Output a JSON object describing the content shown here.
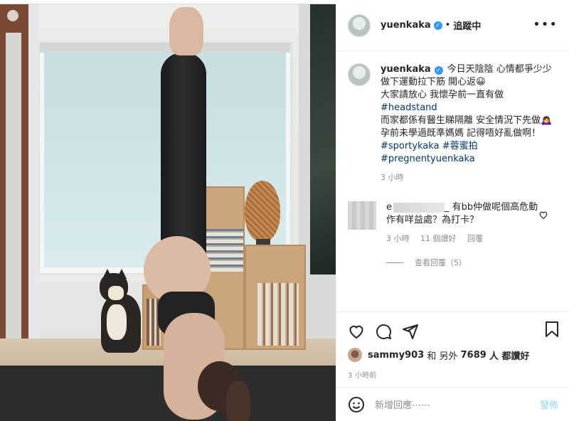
{
  "post": {
    "username": "yuenkaka",
    "separator": "•",
    "follow_label": "追蹤中",
    "more_label": "•••"
  },
  "caption": {
    "username": "yuenkaka",
    "line1": "今日天陰陰 心情都爭少少",
    "line2": "做下運動拉下筋 開心返😀",
    "line3": "大家請放心 我懷孕前一直有做",
    "hashtag1": "#headstand",
    "line4": "而家都係有醫生睇隔離 安全情況下先做🙇‍♀️",
    "line5": "孕前未學過既準媽媽 記得唔好亂做啊！",
    "hashtag2": "#sportykaka",
    "hashtag3": "#蓉蜜拍",
    "hashtag4": "#pregnentyuenkaka",
    "time": "3 小時"
  },
  "comment": {
    "name_start": "e",
    "name_end": "_",
    "text": "有bb仲做呢個高危動作有咩益處？為打卡？",
    "time": "3 小時",
    "likes": "11 個讚好",
    "reply": "回覆",
    "view_replies": "查看回覆（5）"
  },
  "likes": {
    "user": "sammy903",
    "mid": "和 另外",
    "count": "7689",
    "suffix": "人 都讚好"
  },
  "post_time": "3 小時前",
  "add_comment": {
    "placeholder": "新增回應⋯⋯",
    "post_label": "發佈"
  }
}
